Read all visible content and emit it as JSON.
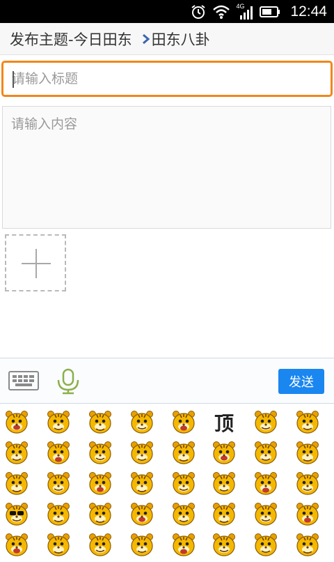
{
  "status_bar": {
    "time": "12:44",
    "network": "4G",
    "icons": [
      "alarm-icon",
      "wifi-icon",
      "signal-icon",
      "battery-icon"
    ]
  },
  "header": {
    "title": "发布主题-今日田东",
    "forum": "田东八卦"
  },
  "form": {
    "title_placeholder": "请输入标题",
    "title_value": "",
    "content_placeholder": "请输入内容",
    "content_value": ""
  },
  "toolbar": {
    "send_label": "发送",
    "keyboard_icon": "keyboard-icon",
    "voice_icon": "microphone-icon"
  },
  "emoji_panel": {
    "special_text": "顶",
    "accent_color": "#f5b800",
    "rows": 5,
    "columns": 8
  },
  "colors": {
    "focus_border": "#f0871a",
    "send_button": "#1a86f0",
    "mic": "#8ab04a"
  }
}
